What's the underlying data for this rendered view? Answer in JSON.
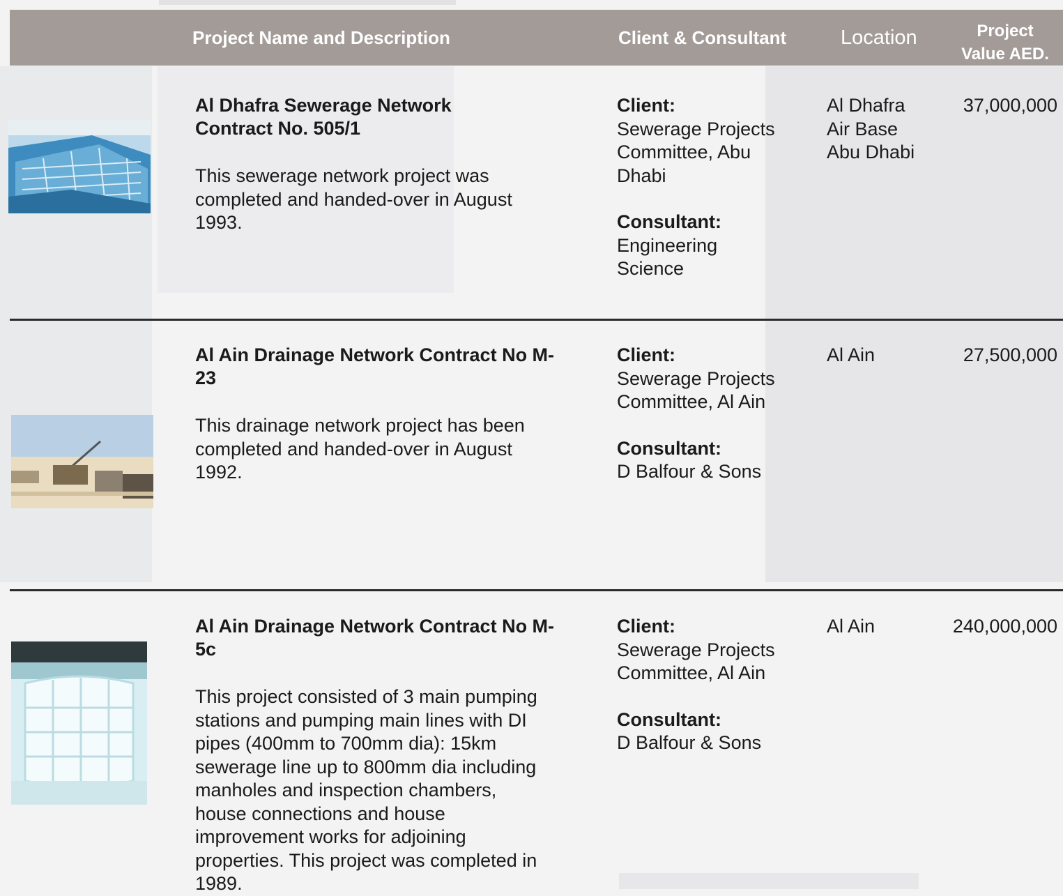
{
  "header": {
    "col_name": "Project Name and Description",
    "col_client": "Client & Consultant",
    "col_location": "Location",
    "col_value_line1": "Project",
    "col_value_line2": "Value AED."
  },
  "projects": [
    {
      "title": "Al Dhafra Sewerage Network Contract No. 505/1",
      "description": "This sewerage network project was completed and handed-over in August 1993.",
      "client_label": "Client:",
      "client": "Sewerage Projects Committee, Abu Dhabi",
      "consultant_label": "Consultant:",
      "consultant": "Engineering Science",
      "location": "Al Dhafra Air Base Abu Dhabi",
      "value": "37,000,000"
    },
    {
      "title": "Al Ain Drainage Network Contract No M-23",
      "description": "This drainage network project has been completed and handed-over in August 1992.",
      "client_label": "Client:",
      "client": "Sewerage Projects Committee, Al Ain",
      "consultant_label": "Consultant:",
      "consultant": "D Balfour & Sons",
      "location": "Al Ain",
      "value": "27,500,000"
    },
    {
      "title": "Al Ain Drainage Network Contract No M-5c",
      "description": "This project consisted of 3 main pumping stations and pumping main lines with DI pipes (400mm to 700mm dia): 15km sewerage line up to 800mm dia including manholes and inspection chambers, house connections and house improvement works for adjoining properties. This project was completed in 1989.",
      "client_label": "Client:",
      "client": "Sewerage Projects Committee, Al Ain",
      "consultant_label": "Consultant:",
      "consultant": "D Balfour & Sons",
      "location": "Al Ain",
      "value": "240,000,000"
    }
  ],
  "colors": {
    "header_bg": "#a39b98",
    "header_text": "#ffffff",
    "divider": "#2a2a2a"
  }
}
